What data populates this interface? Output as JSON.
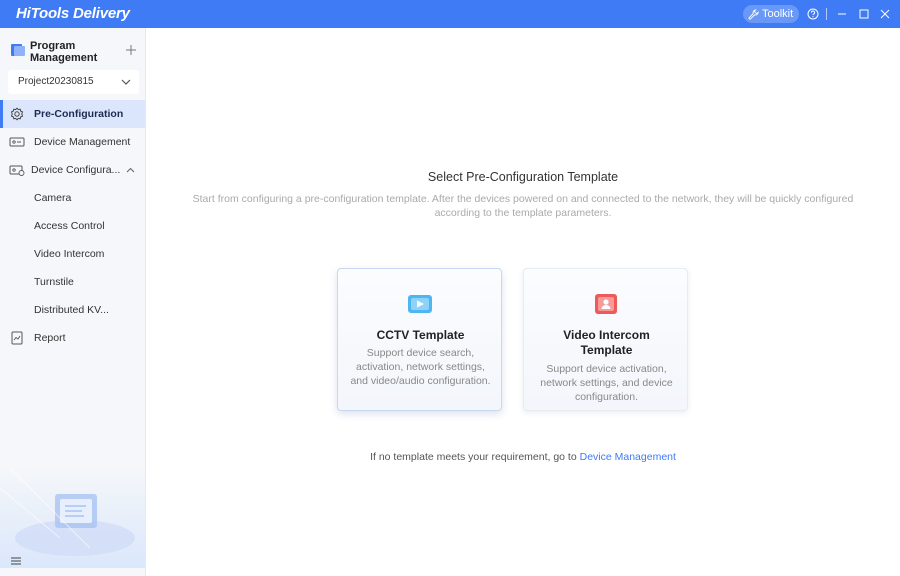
{
  "titlebar": {
    "app_title": "HiTools Delivery",
    "toolkit_label": "Toolkit",
    "help_icon": "help-icon",
    "minimize_icon": "minimize-icon",
    "maximize_icon": "maximize-icon",
    "close_icon": "close-icon",
    "accent": "#3f7bf4"
  },
  "sidebar": {
    "program_management": "Program Management",
    "project": "Project20230815",
    "items": [
      {
        "label": "Pre-Configuration",
        "icon": "gear-icon",
        "active": true
      },
      {
        "label": "Device Management",
        "icon": "device-icon"
      },
      {
        "label": "Device Configura...",
        "icon": "device-config-icon",
        "expanded": true
      },
      {
        "label": "Camera"
      },
      {
        "label": "Access Control"
      },
      {
        "label": "Video Intercom"
      },
      {
        "label": "Turnstile"
      },
      {
        "label": "Distributed KV..."
      },
      {
        "label": "Report",
        "icon": "report-icon"
      }
    ]
  },
  "main": {
    "title": "Select Pre-Configuration Template",
    "description": "Start from configuring a pre-configuration template. After the devices powered on and connected to the network, they will be quickly configured according to the template parameters.",
    "cards": [
      {
        "title": "CCTV Template",
        "description": "Support device search, activation, network settings, and video/audio configuration.",
        "icon": "video-play-icon",
        "color": "#4fb6f2"
      },
      {
        "title": "Video Intercom Template",
        "description": "Support device activation, network settings, and device configuration.",
        "icon": "intercom-user-icon",
        "color": "#ee5a5a"
      }
    ],
    "footer_text": "If no template meets your requirement, go to ",
    "footer_link": "Device Management"
  }
}
